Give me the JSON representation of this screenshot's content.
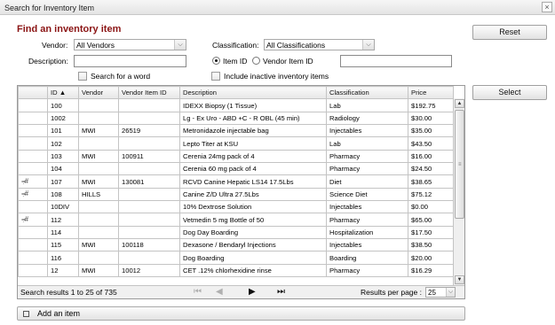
{
  "dialog": {
    "title": "Search for Inventory Item",
    "close": "×"
  },
  "heading": "Find an inventory item",
  "form": {
    "vendor_label": "Vendor:",
    "vendor_value": "All Vendors",
    "classification_label": "Classification:",
    "classification_value": "All Classifications",
    "description_label": "Description:",
    "description_value": "",
    "search_word_label": "Search for a word",
    "radio_item_id": "Item ID",
    "radio_vendor_item_id": "Vendor Item ID",
    "include_inactive_label": "Include inactive inventory items"
  },
  "buttons": {
    "reset": "Reset",
    "select": "Select"
  },
  "table": {
    "columns": [
      "",
      "ID ▲",
      "Vendor",
      "Vendor Item ID",
      "Description",
      "Classification",
      "Price"
    ],
    "rows": [
      {
        "icon": "",
        "id": "100",
        "vendor": "",
        "vendor_item_id": "",
        "description": "IDEXX Biopsy (1 Tissue)",
        "classification": "Lab",
        "price": "$192.75"
      },
      {
        "icon": "",
        "id": "1002",
        "vendor": "",
        "vendor_item_id": "",
        "description": "Lg - Ex Uro - ABD +C - R OBL (45 min)",
        "classification": "Radiology",
        "price": "$30.00"
      },
      {
        "icon": "",
        "id": "101",
        "vendor": "MWI",
        "vendor_item_id": "26519",
        "description": "Metronidazole injectable bag",
        "classification": "Injectables",
        "price": "$35.00"
      },
      {
        "icon": "",
        "id": "102",
        "vendor": "",
        "vendor_item_id": "",
        "description": "Lepto Titer at KSU",
        "classification": "Lab",
        "price": "$43.50"
      },
      {
        "icon": "",
        "id": "103",
        "vendor": "MWI",
        "vendor_item_id": "100911",
        "description": "Cerenia 24mg pack of 4",
        "classification": "Pharmacy",
        "price": "$16.00"
      },
      {
        "icon": "",
        "id": "104",
        "vendor": "",
        "vendor_item_id": "",
        "description": "Cerenia 60 mg pack of 4",
        "classification": "Pharmacy",
        "price": "$24.50"
      },
      {
        "icon": "⩦#",
        "id": "107",
        "vendor": "MWI",
        "vendor_item_id": "130081",
        "description": "RCVD Canine Hepatic LS14 17.5Lbs",
        "classification": "Diet",
        "price": "$38.65"
      },
      {
        "icon": "⩦#",
        "id": "108",
        "vendor": "HILLS",
        "vendor_item_id": "",
        "description": "Canine Z/D Ultra 27.5Lbs",
        "classification": "Science Diet",
        "price": "$75.12"
      },
      {
        "icon": "",
        "id": "10DIV",
        "vendor": "",
        "vendor_item_id": "",
        "description": "10% Dextrose Solution",
        "classification": "Injectables",
        "price": "$0.00"
      },
      {
        "icon": "⩦#",
        "id": "112",
        "vendor": "",
        "vendor_item_id": "",
        "description": "Vetmedin 5 mg Bottle of 50",
        "classification": "Pharmacy",
        "price": "$65.00"
      },
      {
        "icon": "",
        "id": "114",
        "vendor": "",
        "vendor_item_id": "",
        "description": "Dog Day Boarding",
        "classification": "Hospitalization",
        "price": "$17.50"
      },
      {
        "icon": "",
        "id": "115",
        "vendor": "MWI",
        "vendor_item_id": "100118",
        "description": "Dexasone / Bendaryl Injections",
        "classification": "Injectables",
        "price": "$38.50"
      },
      {
        "icon": "",
        "id": "116",
        "vendor": "",
        "vendor_item_id": "",
        "description": "Dog Boarding",
        "classification": "Boarding",
        "price": "$20.00"
      },
      {
        "icon": "",
        "id": "12",
        "vendor": "MWI",
        "vendor_item_id": "10012",
        "description": "CET .12% chlorhexidine rinse",
        "classification": "Pharmacy",
        "price": "$16.29"
      }
    ]
  },
  "footer": {
    "results_text": "Search results 1 to 25 of 735",
    "per_page_label": "Results per page :",
    "per_page_value": "25"
  },
  "add_item": "Add an item"
}
